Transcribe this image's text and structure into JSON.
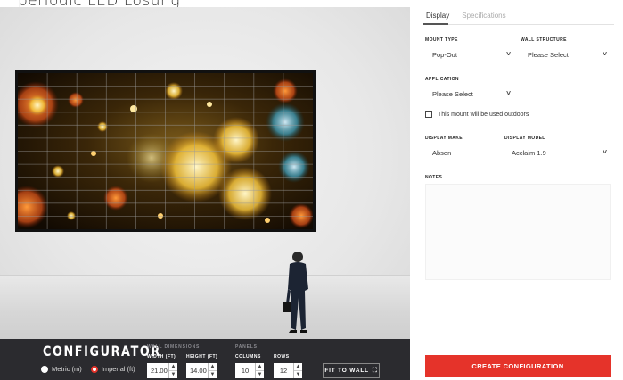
{
  "page": {
    "title": "periodic LED Lösung"
  },
  "configurator": {
    "title": "CONFIGURATOR",
    "units": [
      {
        "label": "Metric (m)",
        "selected": false
      },
      {
        "label": "Imperial (ft)",
        "selected": true
      }
    ],
    "wall_dimensions": {
      "label": "WALL DIMENSIONS",
      "width_label": "WIDTH (FT)",
      "width_value": "21.00",
      "height_label": "HEIGHT (FT)",
      "height_value": "14.00"
    },
    "panels": {
      "label": "PANELS",
      "columns_label": "COLUMNS",
      "columns_value": "10",
      "rows_label": "ROWS",
      "rows_value": "12"
    },
    "fit_button": "FIT TO WALL",
    "fit_icon": "expand-icon"
  },
  "panel": {
    "tabs": [
      {
        "label": "Display",
        "active": true
      },
      {
        "label": "Specifications",
        "active": false
      }
    ],
    "mount_type": {
      "label": "MOUNT TYPE",
      "value": "Pop-Out"
    },
    "wall_structure": {
      "label": "WALL STRUCTURE",
      "value": "Please Select"
    },
    "application": {
      "label": "APPLICATION",
      "value": "Please Select"
    },
    "outdoor_checkbox": {
      "label": "This mount will be used outdoors",
      "checked": false
    },
    "display_make": {
      "label": "DISPLAY MAKE",
      "value": "Absen"
    },
    "display_model": {
      "label": "DISPLAY MODEL",
      "value": "Acclaim 1.9"
    },
    "notes": {
      "label": "NOTES",
      "value": ""
    },
    "create_button": "CREATE CONFIGURATION"
  },
  "colors": {
    "accent": "#e5332a",
    "bar": "#2b2b2f"
  }
}
